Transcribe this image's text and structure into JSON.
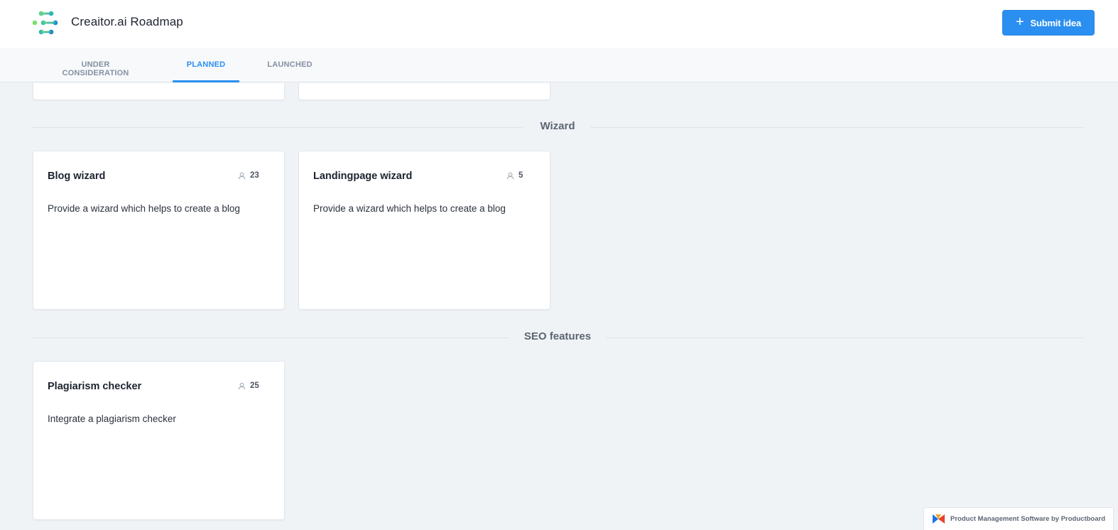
{
  "header": {
    "app_title": "Creaitor.ai Roadmap",
    "submit_label": "Submit idea",
    "submit_icon": "plus-icon"
  },
  "tabs": [
    {
      "label": "UNDER CONSIDERATION",
      "active": false
    },
    {
      "label": "PLANNED",
      "active": true
    },
    {
      "label": "LAUNCHED",
      "active": false
    }
  ],
  "sections": [
    {
      "title": "Wizard",
      "cards": [
        {
          "title": "Blog wizard",
          "votes": "23",
          "description": "Provide a wizard which helps to create a blog"
        },
        {
          "title": "Landingpage wizard",
          "votes": "5",
          "description": "Provide a wizard which helps to create a blog"
        }
      ]
    },
    {
      "title": "SEO features",
      "cards": [
        {
          "title": "Plagiarism checker",
          "votes": "25",
          "description": "Integrate a plagiarism checker"
        }
      ]
    }
  ],
  "footer": {
    "badge_text": "Product Management Software by Productboard"
  },
  "colors": {
    "accent": "#2a8ff0",
    "background": "#f0f3f6",
    "card": "#ffffff",
    "muted_text": "#8590a0"
  }
}
